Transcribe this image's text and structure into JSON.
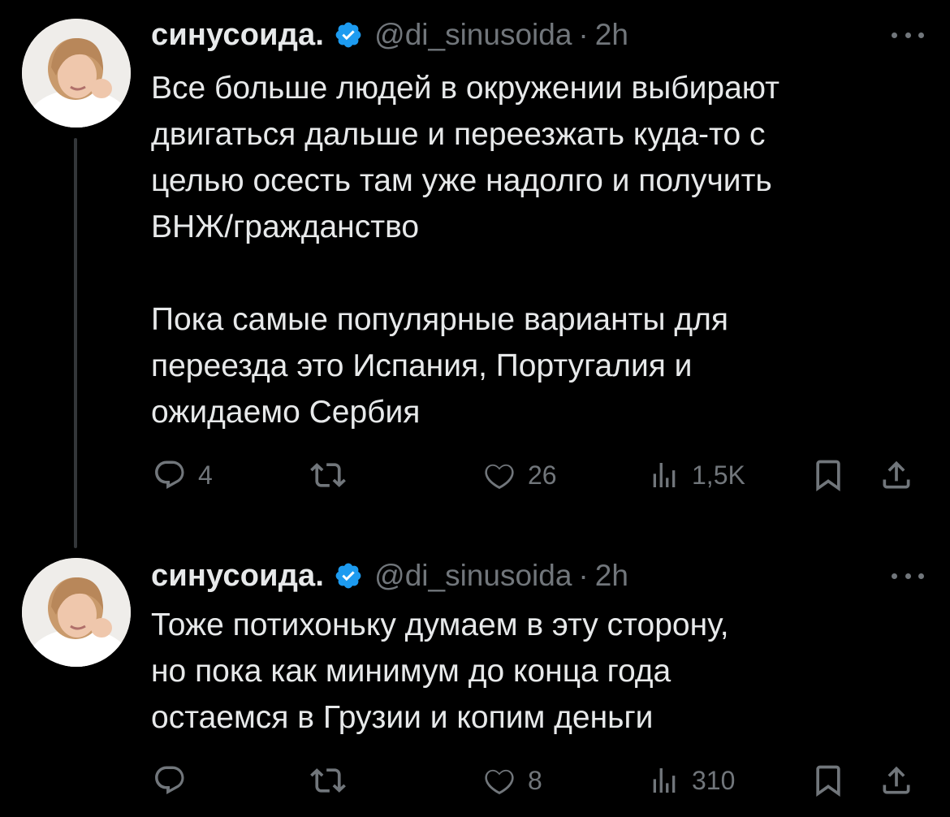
{
  "colors": {
    "background": "#000000",
    "text": "#e7e9ea",
    "secondary": "#71767b",
    "verified": "#1d9bf0",
    "thread_line": "#333639"
  },
  "tweets": [
    {
      "display_name": "синусоида.",
      "handle": "@di_sinusoida",
      "separator": "·",
      "time": "2h",
      "verified_icon": "verified-badge-icon",
      "paragraphs": [
        [
          "Все больше людей в окружении выбирают",
          "двигаться дальше и переезжать куда-то с",
          "целью осесть там уже надолго и получить",
          "ВНЖ/гражданство"
        ],
        [
          "Пока самые популярные варианты для",
          "переезда это Испания, Португалия и",
          "ожидаемо Сербия"
        ]
      ],
      "actions": {
        "reply_count": "4",
        "retweet_count": "",
        "like_count": "26",
        "views_count": "1,5K"
      }
    },
    {
      "display_name": "синусоида.",
      "handle": "@di_sinusoida",
      "separator": "·",
      "time": "2h",
      "verified_icon": "verified-badge-icon",
      "paragraphs": [
        [
          "Тоже потихоньку думаем в эту сторону,",
          "но пока как минимум до конца года",
          "остаемся в Грузии и копим деньги"
        ]
      ],
      "actions": {
        "reply_count": "",
        "retweet_count": "",
        "like_count": "8",
        "views_count": "310"
      }
    }
  ]
}
